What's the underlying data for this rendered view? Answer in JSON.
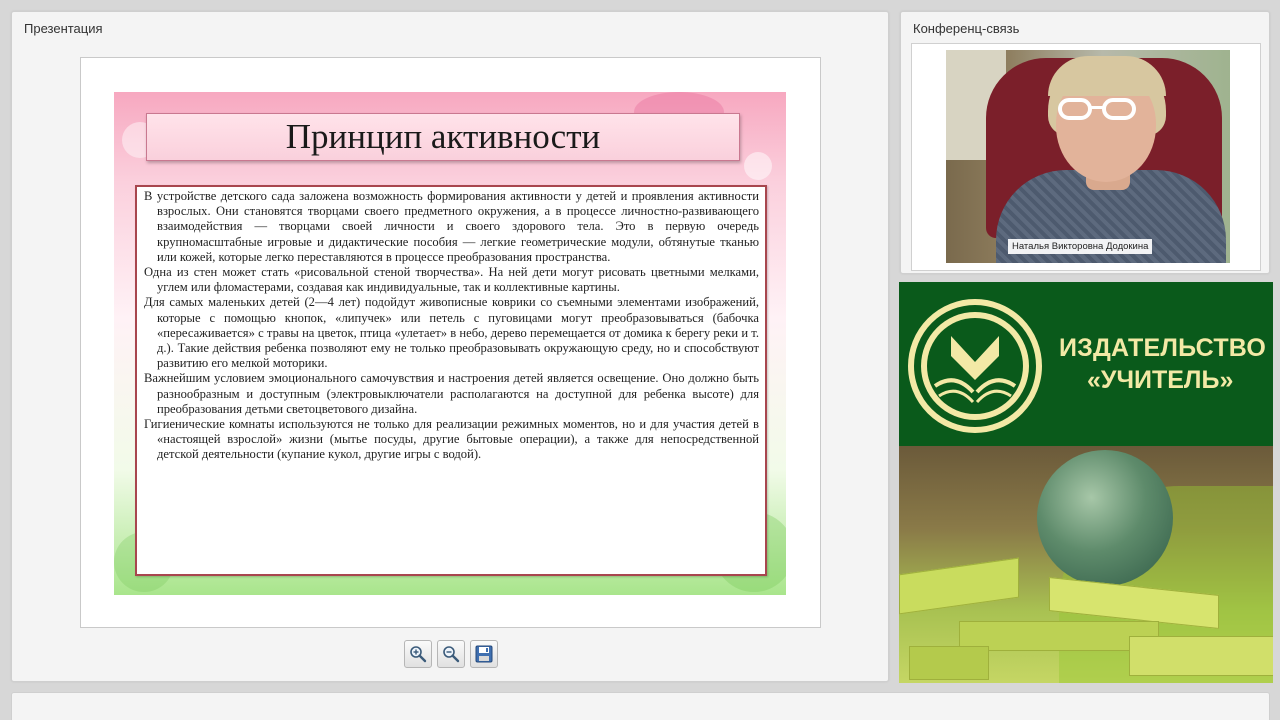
{
  "presentation_panel": {
    "title": "Презентация",
    "slide": {
      "heading": "Принцип активности",
      "paragraphs": [
        "В устройстве детского сада заложена возможность формирования активности у детей и проявления активности взрослых. Они становятся творцами своего предметного окружения, а в процессе личностно-развивающего взаимодействия — творцами своей личности и своего здорового тела. Это в первую очередь крупномасштабные игровые и дидактические пособия — легкие геометрические модули, обтянутые тканью или кожей, которые легко переставляются в процессе преобразования пространства.",
        "Одна из стен может стать «рисовальной стеной творчества». На ней дети могут рисовать цветными мелками, углем или фломастерами, создавая как индивидуальные, так и коллективные картины.",
        "Для самых маленьких детей (2—4 лет) подойдут живописные коврики со съемными элементами изображений, которые с помощью кнопок, «липучек» или петель с пуговицами могут преобразовываться (бабочка «пересаживается» с травы на цветок, птица «улетает» в небо, дерево перемещается от домика к берегу реки и т. д.). Такие действия ребенка позволяют ему не только преобразовывать окружающую среду, но и способствуют развитию его мелкой моторики.",
        "Важнейшим условием эмоционального самочувствия и настроения детей является освещение. Оно должно быть разнообразным и доступным (электровыключатели располагаются на доступной для ребенка высоте) для преобразования детьми светоцветового дизайна.",
        "Гигиенические комнаты используются не только для реализации режимных моментов, но и для участия детей в «настоящей взрослой» жизни (мытье посуды, другие бытовые операции), а также для непосредственной детской деятельности (купание кукол, другие игры с водой)."
      ]
    },
    "toolbar": {
      "zoom_in_icon": "zoom-in-icon",
      "zoom_out_icon": "zoom-out-icon",
      "save_icon": "save-icon"
    }
  },
  "conference_panel": {
    "title": "Конференц-связь",
    "participant_name": "Наталья Викторовна Додокина"
  },
  "banner": {
    "line1": "ИЗДАТЕЛЬСТВО",
    "line2": "«УЧИТЕЛЬ»",
    "colors": {
      "background": "#0a5a1b",
      "text": "#f3e9a6"
    }
  }
}
